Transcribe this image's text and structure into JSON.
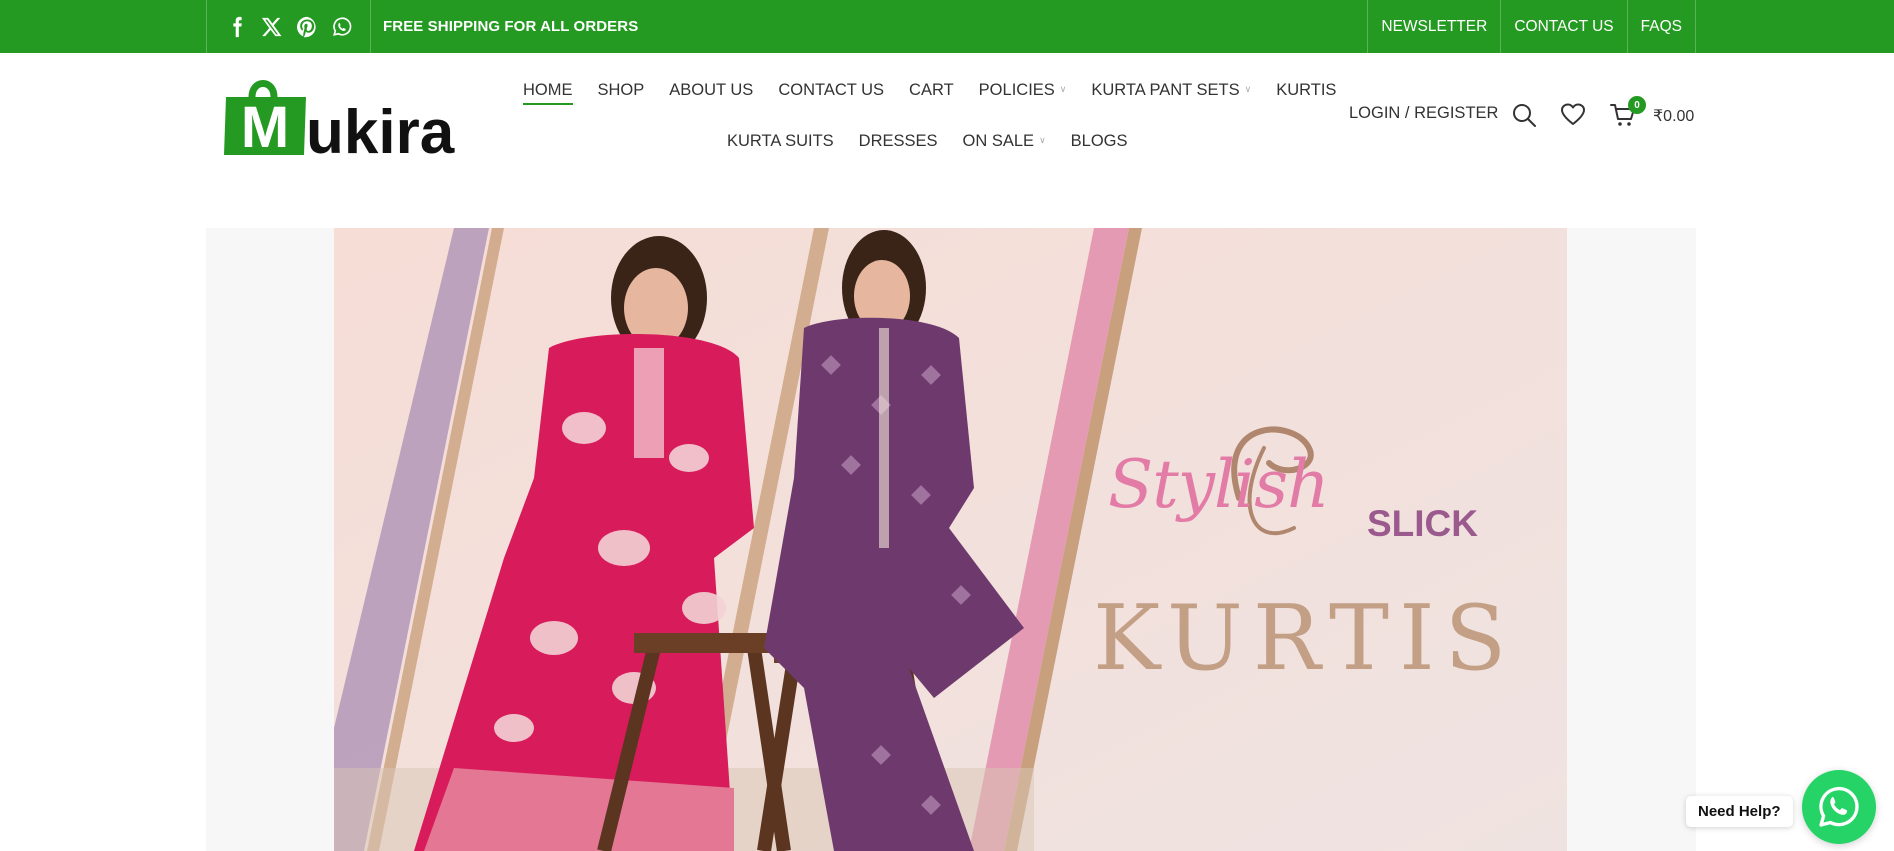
{
  "topbar": {
    "social_icons": [
      "facebook-icon",
      "x-twitter-icon",
      "pinterest-icon",
      "whatsapp-icon"
    ],
    "shipping_text": "FREE SHIPPING FOR ALL ORDERS",
    "links": [
      "NEWSLETTER",
      "CONTACT US",
      "FAQS"
    ],
    "bg_color": "#259a22"
  },
  "header": {
    "logo": {
      "letter": "M",
      "text": "ukira",
      "color": "#259a22"
    },
    "nav_row1": [
      {
        "label": "HOME",
        "active": true,
        "dropdown": false
      },
      {
        "label": "SHOP",
        "dropdown": false
      },
      {
        "label": "ABOUT US",
        "dropdown": false
      },
      {
        "label": "CONTACT US",
        "dropdown": false
      },
      {
        "label": "CART",
        "dropdown": false
      },
      {
        "label": "POLICIES",
        "dropdown": true
      },
      {
        "label": "KURTA PANT SETS",
        "dropdown": true
      },
      {
        "label": "KURTIS",
        "dropdown": false
      }
    ],
    "nav_row2": [
      {
        "label": "KURTA SUITS",
        "dropdown": false
      },
      {
        "label": "DRESSES",
        "dropdown": false
      },
      {
        "label": "ON SALE",
        "dropdown": true
      },
      {
        "label": "BLOGS",
        "dropdown": false
      }
    ],
    "login_label": "LOGIN / REGISTER",
    "cart_count": "0",
    "cart_total": "₹0.00",
    "icons": [
      "search-icon",
      "heart-icon",
      "cart-icon"
    ]
  },
  "hero": {
    "headline_script": "Stylish",
    "headline_small": "SLICK",
    "headline_big": "KURTIS",
    "colors": {
      "pink": "#e27ba5",
      "purple": "#9a5a8e",
      "tan": "#c39f85",
      "background": "#efe3e1"
    }
  },
  "help_widget": {
    "label": "Need Help?",
    "icon": "whatsapp-icon",
    "color": "#25d366"
  }
}
